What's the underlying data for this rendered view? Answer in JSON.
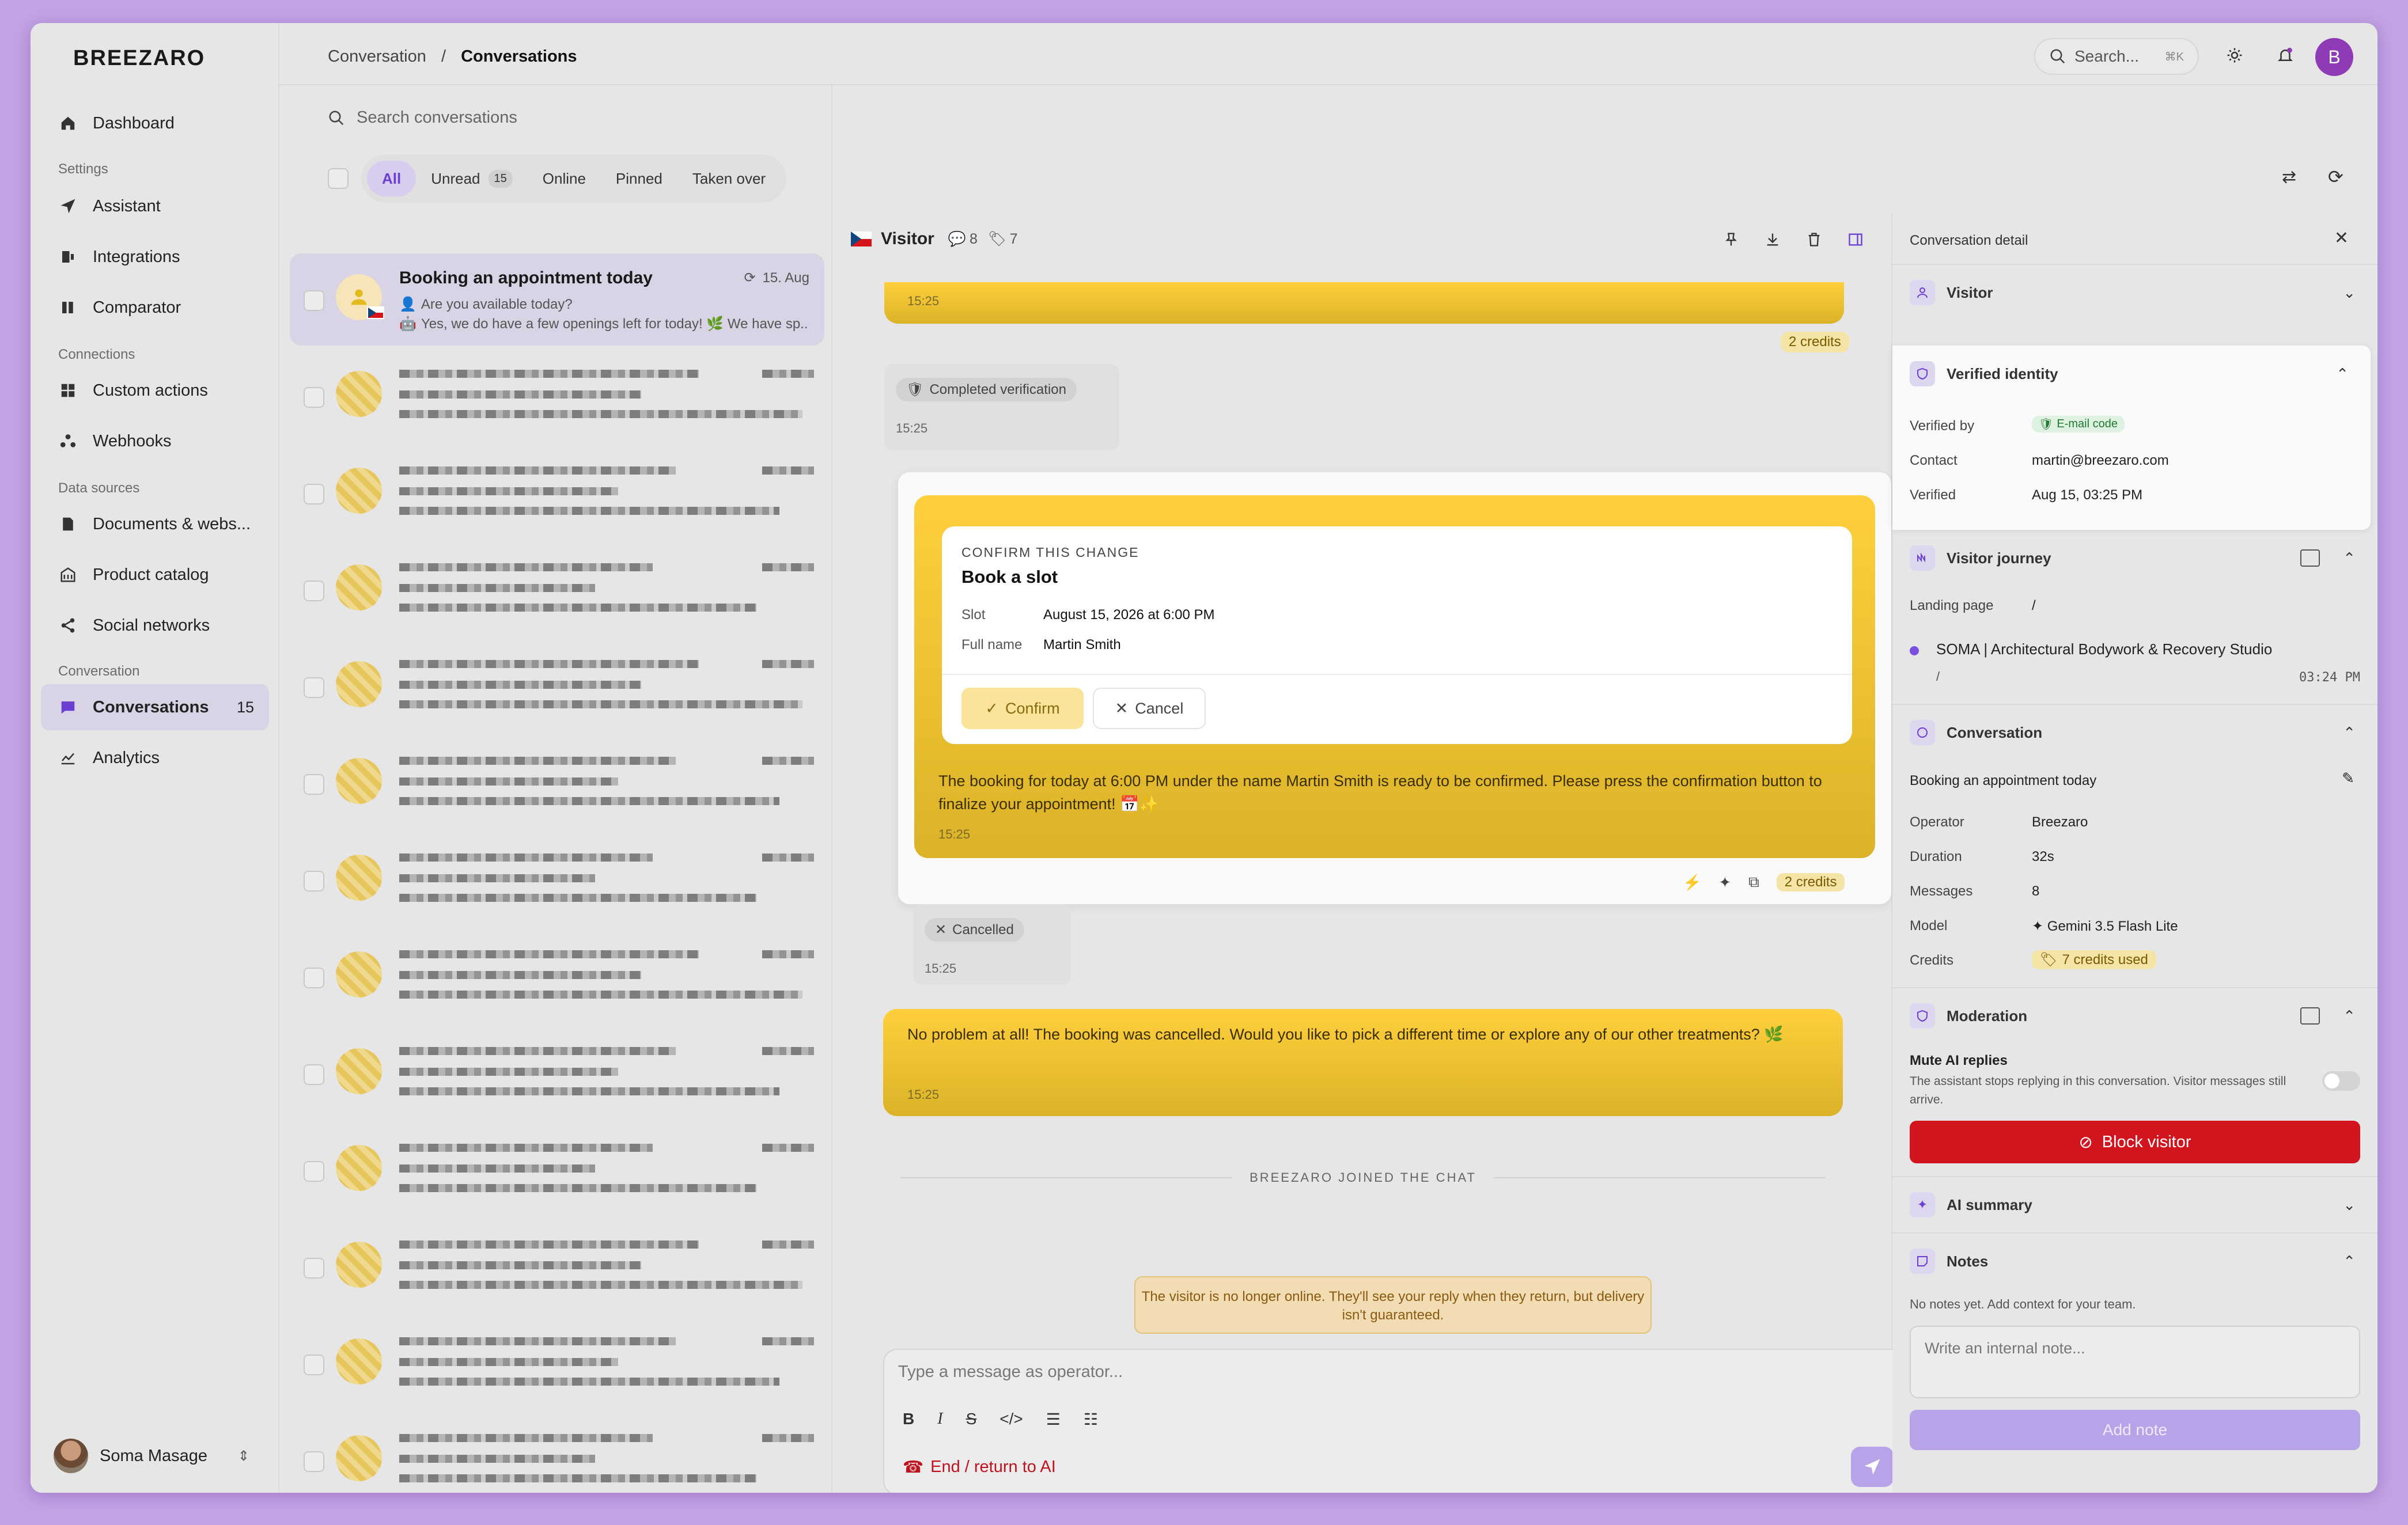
{
  "app": {
    "logo": "BREEZARO"
  },
  "sidebar": {
    "items": [
      {
        "label": "Dashboard",
        "icon": "home-icon"
      },
      {
        "label": "Assistant",
        "icon": "send-icon"
      },
      {
        "label": "Integrations",
        "icon": "plug-icon"
      },
      {
        "label": "Comparator",
        "icon": "columns-icon"
      },
      {
        "label": "Custom actions",
        "icon": "grid-icon"
      },
      {
        "label": "Webhooks",
        "icon": "webhook-icon"
      },
      {
        "label": "Documents & webs...",
        "icon": "document-icon"
      },
      {
        "label": "Product catalog",
        "icon": "catalog-icon"
      },
      {
        "label": "Social networks",
        "icon": "share-icon"
      },
      {
        "label": "Conversations",
        "icon": "chat-icon",
        "badge": "15"
      },
      {
        "label": "Analytics",
        "icon": "chart-icon"
      }
    ],
    "sections": {
      "settings": "Settings",
      "connections": "Connections",
      "data_sources": "Data sources",
      "conversation": "Conversation"
    },
    "user": {
      "name": "Soma Masage"
    }
  },
  "header": {
    "breadcrumb_parent": "Conversation",
    "breadcrumb_sep": "/",
    "breadcrumb_current": "Conversations",
    "search_placeholder": "Search...",
    "search_kbd": "⌘K",
    "avatar_letter": "B"
  },
  "list": {
    "search_placeholder": "Search conversations",
    "filters": [
      {
        "label": "All"
      },
      {
        "label": "Unread",
        "count": "15"
      },
      {
        "label": "Online"
      },
      {
        "label": "Pinned"
      },
      {
        "label": "Taken over"
      }
    ],
    "selected": {
      "title": "Booking an appointment today",
      "date": "15. Aug",
      "line2": "Are you available today?",
      "line3": "Yes, we do have a few openings left for today! 🌿 We have sp..."
    }
  },
  "chat": {
    "visitor_label": "Visitor",
    "messages_count": "8",
    "tags_count": "7",
    "msg_time_1": "15:25",
    "credits_1": "2 credits",
    "verification_pill": "Completed verification",
    "verification_time": "15:25",
    "confirm": {
      "eyebrow": "CONFIRM THIS CHANGE",
      "title": "Book a slot",
      "slot_label": "Slot",
      "slot_value": "August 15, 2026 at 6:00 PM",
      "name_label": "Full name",
      "name_value": "Martin Smith",
      "confirm_btn": "Confirm",
      "cancel_btn": "Cancel"
    },
    "booking_text": "The booking for today at 6:00 PM under the name Martin Smith is ready to be confirmed. Please press the confirmation button to finalize your appointment! 📅✨",
    "booking_time": "15:25",
    "credits_2": "2 credits",
    "cancelled_pill": "Cancelled",
    "cancelled_time": "15:25",
    "noproblem_text": "No problem at all! The booking was cancelled. Would you like to pick a different time or explore any of our other treatments? 🌿",
    "noproblem_time": "15:25",
    "joined": "BREEZARO JOINED THE CHAT",
    "offline_notice": "The visitor is no longer online. They'll see your reply when they return, but delivery isn't guaranteed.",
    "composer_placeholder": "Type a message as operator...",
    "end_ai": "End / return to AI"
  },
  "detail": {
    "title": "Conversation detail",
    "visitor": "Visitor",
    "verified_identity": "Verified identity",
    "verified_by_label": "Verified by",
    "verified_by_value": "E-mail code",
    "contact_label": "Contact",
    "contact_value": "martin@breezaro.com",
    "verified_label": "Verified",
    "verified_value": "Aug 15, 03:25 PM",
    "journey": "Visitor journey",
    "landing_label": "Landing page",
    "landing_value": "/",
    "journey_page": "SOMA | Architectural Bodywork & Recovery Studio",
    "journey_path": "/",
    "journey_time": "03:24 PM",
    "conversation": "Conversation",
    "conv_title": "Booking an appointment today",
    "operator_label": "Operator",
    "operator_value": "Breezaro",
    "duration_label": "Duration",
    "duration_value": "32s",
    "messages_label": "Messages",
    "messages_value": "8",
    "model_label": "Model",
    "model_value": "Gemini 3.5 Flash Lite",
    "credits_label": "Credits",
    "credits_value": "7 credits used",
    "moderation": "Moderation",
    "mute_title": "Mute AI replies",
    "mute_desc": "The assistant stops replying in this conversation. Visitor messages still arrive.",
    "block_btn": "Block visitor",
    "ai_summary": "AI summary",
    "notes": "Notes",
    "notes_empty": "No notes yet. Add context for your team.",
    "note_placeholder": "Write an internal note...",
    "add_note": "Add note"
  },
  "colors": {
    "accent": "#6b3fd1",
    "bubble": "#ffcf3d",
    "danger": "#d2141f"
  }
}
